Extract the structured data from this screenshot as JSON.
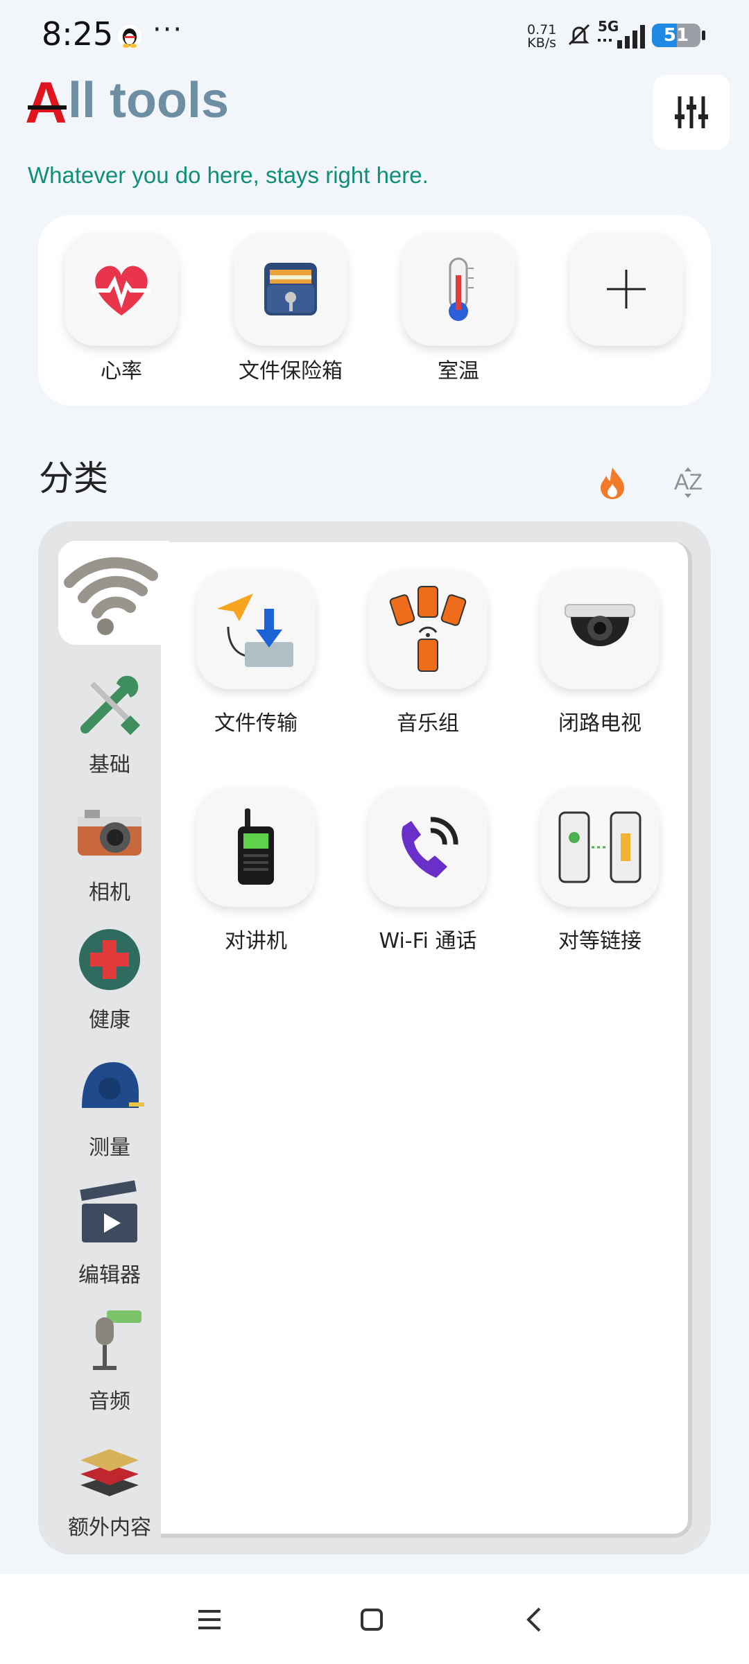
{
  "status_bar": {
    "time": "8:25",
    "more": "···",
    "net_speed_value": "0.71",
    "net_speed_unit": "KB/s",
    "network": "5G",
    "battery": "51",
    "battery_level": 0.51,
    "icons": [
      "qq-icon",
      "mute-icon",
      "signal-icon",
      "battery-icon"
    ]
  },
  "header": {
    "logo_letter": "A",
    "title": "ll tools",
    "subtitle": "Whatever you do here, stays right here.",
    "settings_icon": "sliders-icon"
  },
  "favorites": [
    {
      "label": "心率",
      "icon": "heart-rate-icon"
    },
    {
      "label": "文件保险箱",
      "icon": "file-vault-icon"
    },
    {
      "label": "室温",
      "icon": "thermometer-icon"
    },
    {
      "label": "",
      "icon": "plus-icon"
    }
  ],
  "categories": {
    "heading": "分类",
    "sort_icons": [
      "flame-icon",
      "az-sort-icon"
    ],
    "sidebar": [
      {
        "label": "",
        "icon": "wifi-icon",
        "selected": true
      },
      {
        "label": "基础",
        "icon": "tools-icon"
      },
      {
        "label": "相机",
        "icon": "camera-icon"
      },
      {
        "label": "健康",
        "icon": "health-cross-icon"
      },
      {
        "label": "测量",
        "icon": "tape-measure-icon"
      },
      {
        "label": "编辑器",
        "icon": "clapperboard-icon"
      },
      {
        "label": "音频",
        "icon": "microphone-icon"
      },
      {
        "label": "额外内容",
        "icon": "layers-icon"
      }
    ],
    "tools": [
      {
        "label": "文件传输",
        "icon": "file-transfer-icon"
      },
      {
        "label": "音乐组",
        "icon": "music-group-icon"
      },
      {
        "label": "闭路电视",
        "icon": "cctv-camera-icon"
      },
      {
        "label": "对讲机",
        "icon": "walkie-talkie-icon"
      },
      {
        "label": "Wi-Fi 通话",
        "icon": "wifi-call-icon"
      },
      {
        "label": "对等链接",
        "icon": "peer-link-icon"
      }
    ]
  },
  "nav_bar": {
    "icons": [
      "menu-icon",
      "home-icon",
      "back-icon"
    ]
  },
  "colors": {
    "background": "#f2f5fa",
    "logo_red": "#e0141c",
    "title": "#6d8ea3",
    "subtitle": "#0f8f7a",
    "battery_fill": "#1e88e5"
  }
}
